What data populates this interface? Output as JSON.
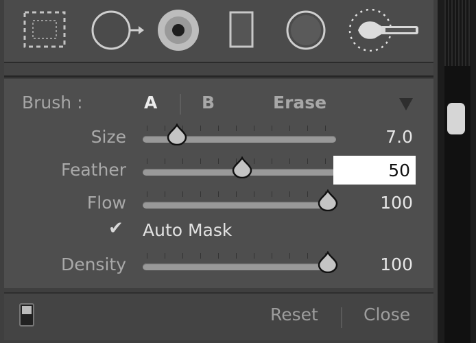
{
  "toolstrip": {
    "tools": [
      {
        "name": "crop-overlay-tool",
        "icon": "marquee-dotted-icon"
      },
      {
        "name": "spot-removal-tool",
        "icon": "circle-arrow-icon"
      },
      {
        "name": "red-eye-tool",
        "icon": "eye-circle-icon"
      },
      {
        "name": "graduated-filter-tool",
        "icon": "rectangle-icon"
      },
      {
        "name": "radial-filter-tool",
        "icon": "circle-icon"
      },
      {
        "name": "adjustment-brush-tool",
        "icon": "brush-icon"
      }
    ]
  },
  "brush": {
    "label": "Brush :",
    "options": {
      "a": "A",
      "b": "B",
      "erase": "Erase"
    },
    "active_option": "A"
  },
  "sliders": {
    "size": {
      "label": "Size",
      "value": "7.0",
      "position": 0.12
    },
    "feather": {
      "label": "Feather",
      "value": "50",
      "position": 0.5
    },
    "flow": {
      "label": "Flow",
      "value": "100",
      "position": 1.0
    },
    "density": {
      "label": "Density",
      "value": "100",
      "position": 1.0
    }
  },
  "auto_mask": {
    "label": "Auto Mask",
    "checked": true
  },
  "footer": {
    "reset": "Reset",
    "close": "Close"
  },
  "colors": {
    "panel": "#4e4e4e",
    "track": "#999999",
    "text": "#a9a9a9",
    "value_box": "#ffffff"
  }
}
